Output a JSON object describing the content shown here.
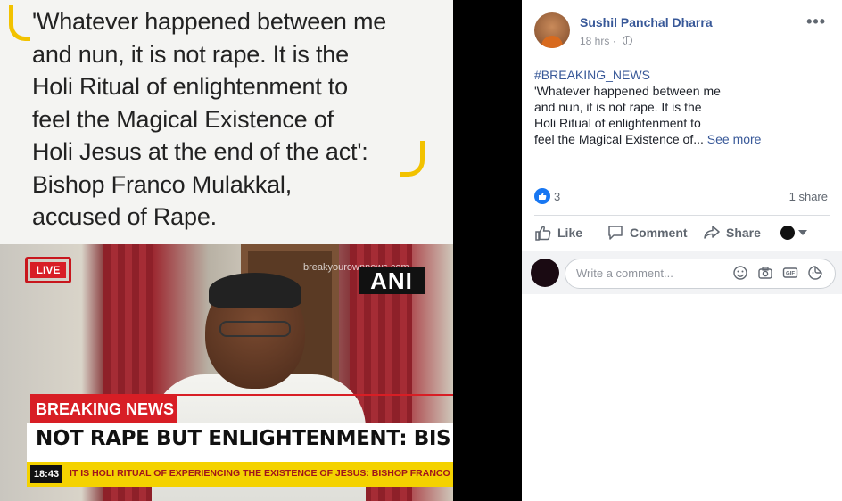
{
  "media": {
    "quote_lines": [
      "'Whatever happened between me",
      "and nun, it is not rape. It is the",
      "Holi Ritual of enlightenment to",
      "feel the Magical Existence of",
      "Holi Jesus at the end of the act':",
      "Bishop Franco Mulakkal,",
      "accused of Rape."
    ],
    "tv": {
      "live_label": "LIVE",
      "watermark": "breakyourownnews.com",
      "channel_logo": "ANI",
      "breaking_label": "BREAKING NEWS",
      "headline": "NOT RAPE BUT ENLIGHTENMENT: BIS",
      "ticker_time": "18:43",
      "ticker_text": "IT IS HOLI RITUAL OF EXPERIENCING THE EXISTENCE OF JESUS: BISHOP FRANCO MULA"
    }
  },
  "post": {
    "author": "Sushil Panchal Dharra",
    "time": "18 hrs",
    "privacy_icon": "globe-icon",
    "more_label": "•••",
    "hashtag": "#BREAKING_NEWS",
    "body_lines": [
      "'Whatever happened between me",
      "and nun, it is not rape. It is the",
      "Holi Ritual of enlightenment to"
    ],
    "last_line": "feel the Magical Existence of...",
    "see_more": "See more",
    "reaction_count": "3",
    "share_count": "1 share",
    "actions": {
      "like": "Like",
      "comment": "Comment",
      "share": "Share"
    },
    "comment_placeholder": "Write a comment...",
    "comment_icons": [
      "emoji-icon",
      "camera-icon",
      "gif-icon",
      "sticker-icon"
    ],
    "colors": {
      "link": "#385898",
      "like_badge": "#1877f2",
      "highlight": "#f2c200",
      "breaking_red": "#d81e25",
      "ticker_yellow": "#f4d200"
    }
  }
}
